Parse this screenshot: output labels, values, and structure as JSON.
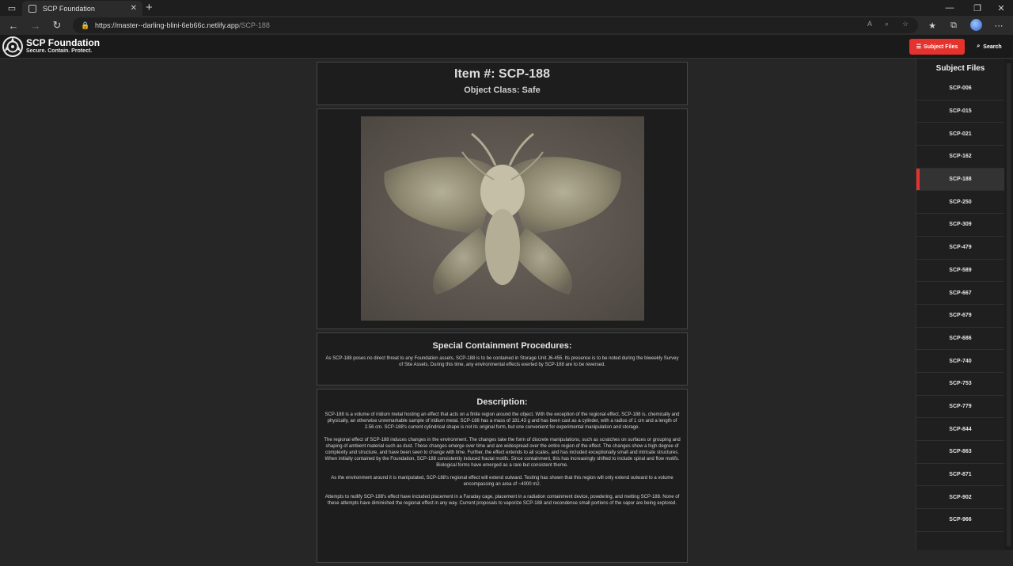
{
  "browser": {
    "tab_title": "SCP Foundation",
    "url_host": "https://master--darling-blini-6eb66c.netlify.app",
    "url_path": "/SCP-188"
  },
  "site": {
    "title": "SCP Foundation",
    "motto": "Secure. Contain. Protect.",
    "subject_files_button": "Subject Files",
    "search_button": "Search"
  },
  "item": {
    "number": "Item #: SCP-188",
    "object_class": "Object Class: Safe"
  },
  "containment": {
    "heading": "Special Containment Procedures:",
    "text": "As SCP-188 poses no direct threat to any Foundation assets, SCP-188 is to be contained in Storage Unit J6-455. Its presence is to be noted during the biweekly Survey of Site Assets. During this time, any environmental effects exerted by SCP-188 are to be reversed."
  },
  "description": {
    "heading": "Description:",
    "paragraphs": [
      "SCP-188 is a volume of iridium metal hosting an effect that acts on a finite region around the object. With the exception of the regional effect, SCP-188 is, chemically and physically, an otherwise unremarkable sample of iridium metal. SCP-188 has a mass of 181.43 g and has been cast as a cylinder, with a radius of 1 cm and a length of 2.56 cm. SCP-188's current cylindrical shape is not its original form, but one convenient for experimental manipulation and storage.",
      "The regional effect of SCP-188 induces changes in the environment. The changes take the form of discrete manipulations, such as scratches on surfaces or grouping and shaping of ambient material such as dust. These changes emerge over time and are widespread over the entire region of the effect. The changes show a high degree of complexity and structure, and have been seen to change with time. Further, the effect extends to all scales, and has included exceptionally small and intricate structures. When initially contained by the Foundation, SCP-188 consistently induced fractal motifs. Since containment, this has increasingly shifted to include spiral and flow motifs. Biological forms have emerged as a rare but consistent theme.",
      "As the environment around it is manipulated, SCP-188's regional effect will extend outward. Testing has shown that this region will only extend outward to a volume encompassing an area of ~4000 m2.",
      "Attempts to nullify SCP-188's effect have included placement in a Faraday cage, placement in a radiation containment device, powdering, and melting SCP-188. None of these attempts have diminished the regional effect in any way. Current proposals to vaporize SCP-188 and recondense small portions of the vapor are being explored."
    ]
  },
  "sidebar": {
    "title": "Subject Files",
    "items": [
      "SCP-006",
      "SCP-015",
      "SCP-021",
      "SCP-162",
      "SCP-188",
      "SCP-250",
      "SCP-309",
      "SCP-479",
      "SCP-589",
      "SCP-667",
      "SCP-679",
      "SCP-686",
      "SCP-740",
      "SCP-753",
      "SCP-779",
      "SCP-844",
      "SCP-863",
      "SCP-871",
      "SCP-902",
      "SCP-966"
    ],
    "active": "SCP-188"
  },
  "colors": {
    "accent": "#e5322d",
    "background": "#262626",
    "card": "#1d1d1d"
  }
}
